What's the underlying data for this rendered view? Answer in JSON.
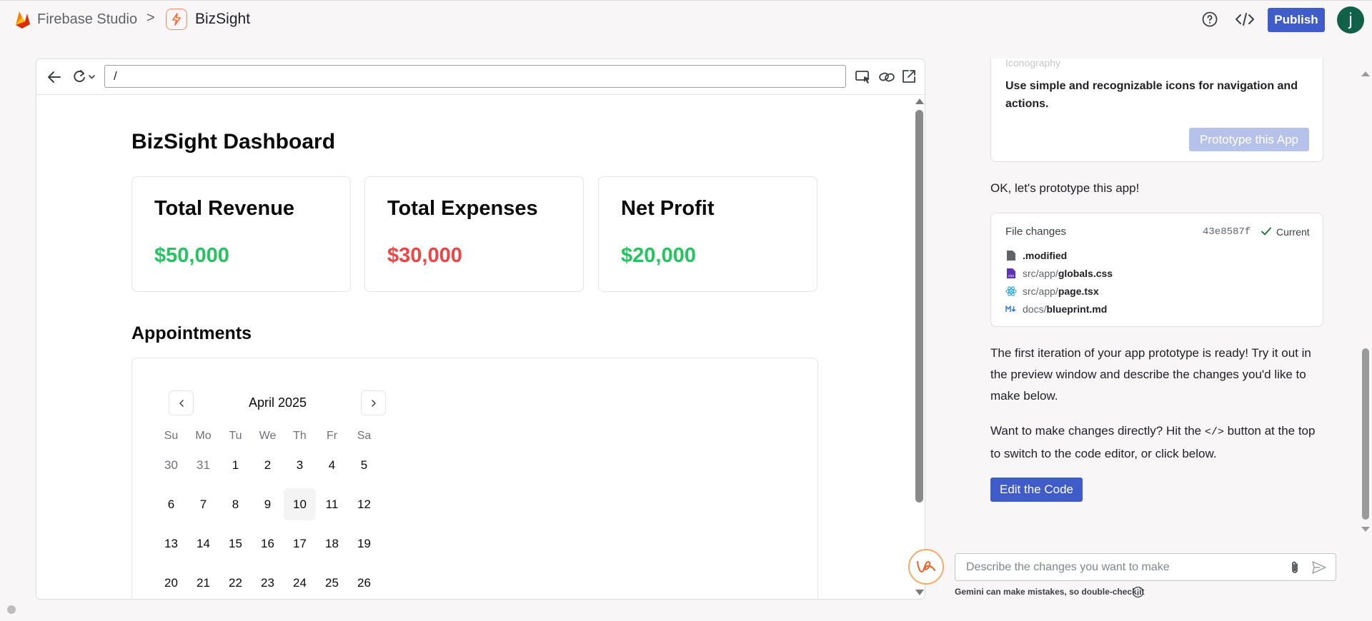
{
  "header": {
    "studio_name": "Firebase Studio",
    "separator": ">",
    "project_name": "BizSight",
    "publish_label": "Publish",
    "avatar_initial": "j"
  },
  "browser": {
    "url": "/"
  },
  "dashboard": {
    "title": "BizSight Dashboard",
    "cards": [
      {
        "label": "Total Revenue",
        "value": "$50,000",
        "color": "#22c55e"
      },
      {
        "label": "Total Expenses",
        "value": "$30,000",
        "color": "#ef4444"
      },
      {
        "label": "Net Profit",
        "value": "$20,000",
        "color": "#22c55e"
      }
    ],
    "appointments_title": "Appointments",
    "calendar": {
      "month": "April 2025",
      "weekdays": [
        "Su",
        "Mo",
        "Tu",
        "We",
        "Th",
        "Fr",
        "Sa"
      ],
      "weeks": [
        [
          "30",
          "31",
          "1",
          "2",
          "3",
          "4",
          "5"
        ],
        [
          "6",
          "7",
          "8",
          "9",
          "10",
          "11",
          "12"
        ],
        [
          "13",
          "14",
          "15",
          "16",
          "17",
          "18",
          "19"
        ],
        [
          "20",
          "21",
          "22",
          "23",
          "24",
          "25",
          "26"
        ]
      ],
      "outside_days": [
        "30",
        "31"
      ],
      "today": "10"
    }
  },
  "chat": {
    "blueprint_faded": "Iconography",
    "blueprint_text": "Use simple and recognizable icons for navigation and actions.",
    "prototype_button": "Prototype this App",
    "ok_message": "OK, let's prototype this app!",
    "file_changes": {
      "title": "File changes",
      "hash": "43e8587f",
      "status": "Current",
      "files": [
        {
          "dir": "",
          "name": ".modified",
          "icon": "file-icon"
        },
        {
          "dir": "src/app/",
          "name": "globals.css",
          "icon": "css-icon"
        },
        {
          "dir": "src/app/",
          "name": "page.tsx",
          "icon": "react-icon"
        },
        {
          "dir": "docs/",
          "name": "blueprint.md",
          "icon": "markdown-icon"
        }
      ]
    },
    "message_1": "The first iteration of your app prototype is ready! Try it out in the preview window and describe the changes you'd like to make below.",
    "message_2_before": "Want to make changes directly? Hit the ",
    "message_2_code": "</>",
    "message_2_after": " button at the top to switch to the code editor, or click below.",
    "edit_button": "Edit the Code",
    "input_placeholder": "Describe the changes you want to make",
    "disclaimer": "Gemini can make mistakes, so double-check it"
  },
  "colors": {
    "accent": "#3f5cc9",
    "accent_disabled": "#b7c2ea",
    "avatar": "#116149",
    "positive": "#22c55e",
    "negative": "#ef4444"
  }
}
